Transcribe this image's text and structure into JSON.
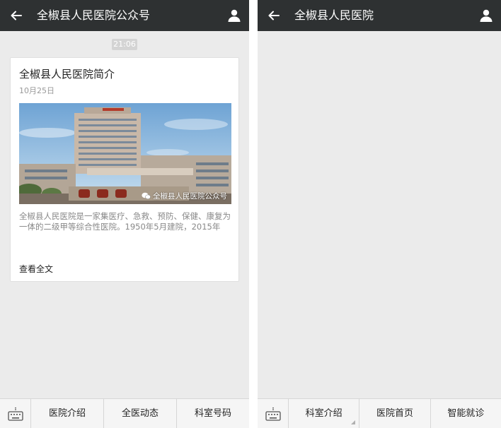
{
  "left": {
    "title": "全椒县人民医院公众号",
    "timestamp": "21:06",
    "article": {
      "title": "全椒县人民医院简介",
      "date": "10月25日",
      "watermark": "全椒县人民医院公众号",
      "description": "全椒县人民医院是一家集医疗、急救、预防、保健、康复为一体的二级甲等综合性医院。1950年5月建院，2015年",
      "read_more": "查看全文"
    },
    "menu": [
      {
        "label": "医院介绍"
      },
      {
        "label": "全医动态"
      },
      {
        "label": "科室号码"
      }
    ]
  },
  "right": {
    "title": "全椒县人民医院",
    "menu": [
      {
        "label": "科室介绍"
      },
      {
        "label": "医院首页"
      },
      {
        "label": "智能就诊"
      }
    ]
  },
  "colors": {
    "titlebar": "#2e3132",
    "background": "#ebebeb",
    "menubar": "#f5f5f5"
  },
  "icons": {
    "back": "arrow-left-icon",
    "profile": "person-icon",
    "keyboard": "keyboard-icon",
    "wechat": "wechat-icon"
  }
}
